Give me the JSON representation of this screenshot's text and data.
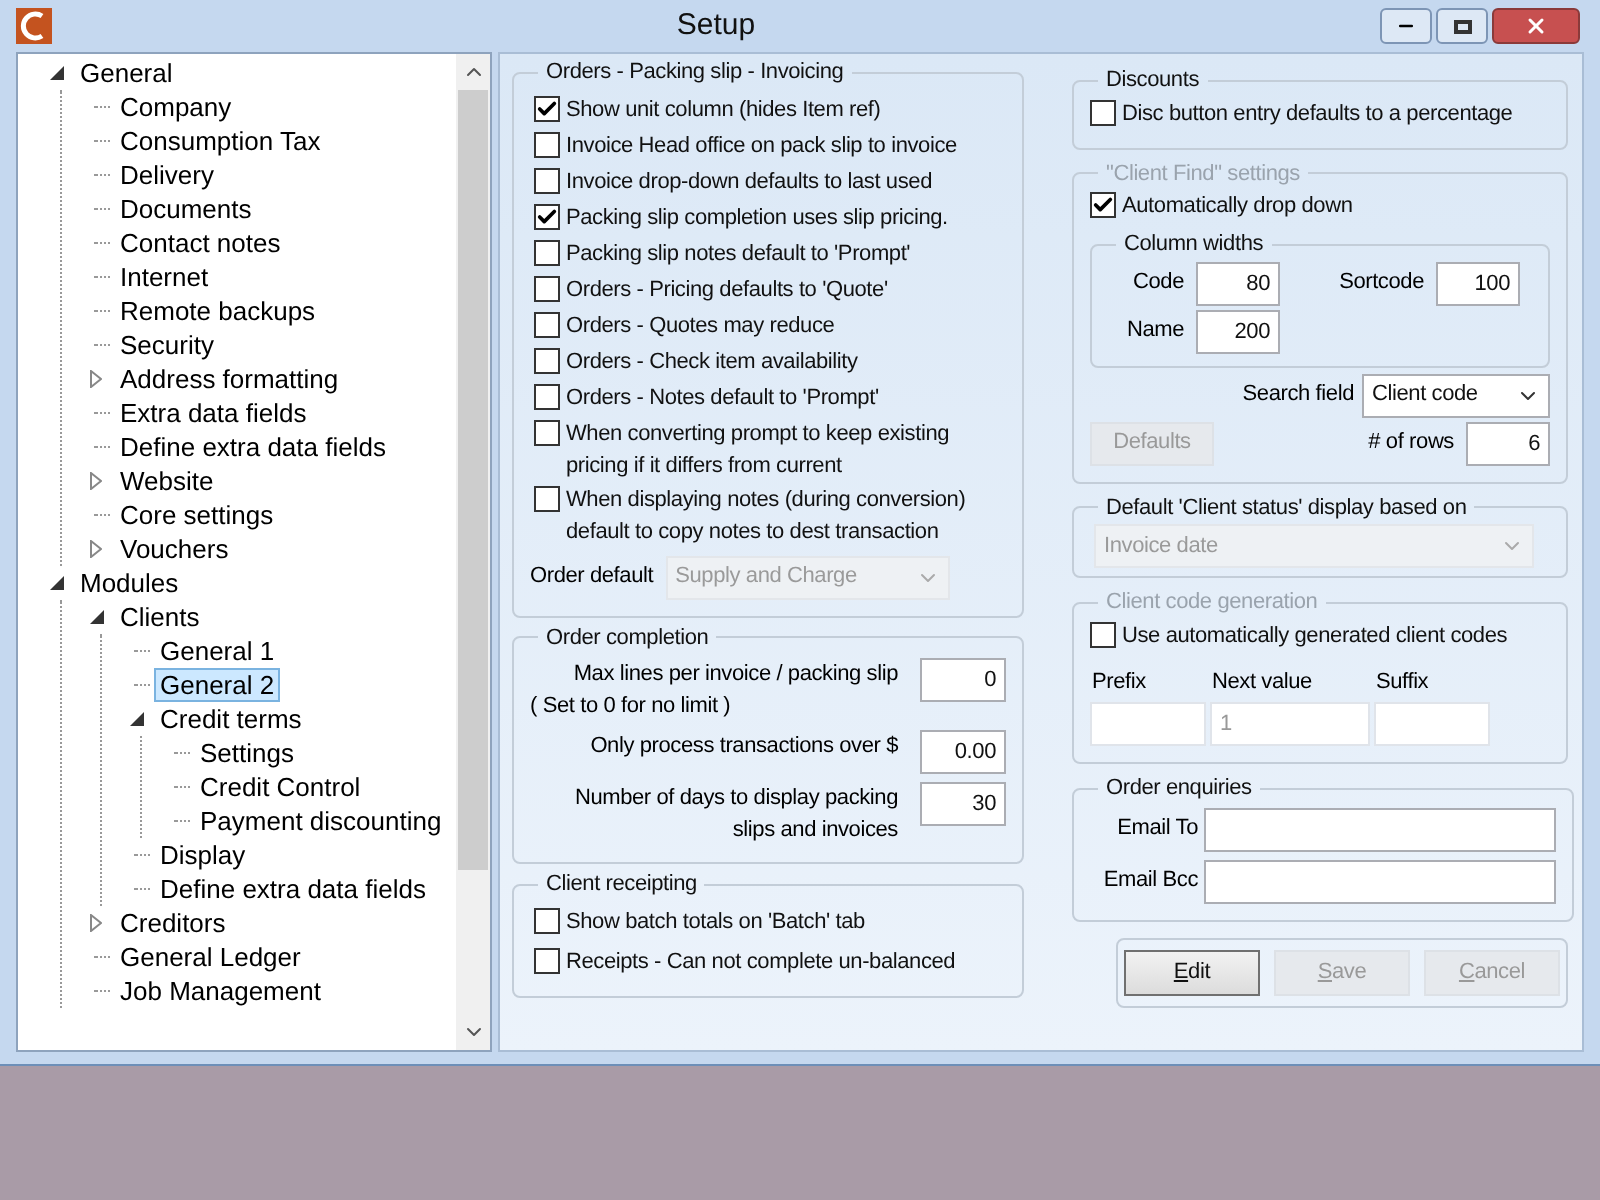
{
  "window": {
    "title": "Setup"
  },
  "tree": {
    "items": [
      {
        "label": "General",
        "expanded": true,
        "selected": false,
        "children": [
          {
            "label": "Company",
            "selected": false
          },
          {
            "label": "Consumption Tax",
            "selected": false
          },
          {
            "label": "Delivery",
            "selected": false
          },
          {
            "label": "Documents",
            "selected": false
          },
          {
            "label": "Contact notes",
            "selected": false
          },
          {
            "label": "Internet",
            "selected": false
          },
          {
            "label": "Remote backups",
            "selected": false
          },
          {
            "label": "Security",
            "selected": false
          },
          {
            "label": "Address formatting",
            "expanded": false,
            "selected": false
          },
          {
            "label": "Extra data fields",
            "selected": false
          },
          {
            "label": "Define extra data fields",
            "selected": false
          },
          {
            "label": "Website",
            "expanded": false,
            "selected": false
          },
          {
            "label": "Core settings",
            "selected": false
          },
          {
            "label": "Vouchers",
            "expanded": false,
            "selected": false
          }
        ]
      },
      {
        "label": "Modules",
        "expanded": true,
        "selected": false,
        "children": [
          {
            "label": "Clients",
            "expanded": true,
            "selected": false,
            "children": [
              {
                "label": "General 1",
                "selected": false
              },
              {
                "label": "General 2",
                "selected": true
              },
              {
                "label": "Credit terms",
                "expanded": true,
                "selected": false,
                "children": [
                  {
                    "label": "Settings",
                    "selected": false
                  },
                  {
                    "label": "Credit Control",
                    "selected": false
                  },
                  {
                    "label": "Payment discounting",
                    "selected": false
                  }
                ]
              },
              {
                "label": "Display",
                "selected": false
              },
              {
                "label": "Define extra data fields",
                "selected": false
              }
            ]
          },
          {
            "label": "Creditors",
            "expanded": false,
            "selected": false
          },
          {
            "label": "General Ledger",
            "selected": false
          },
          {
            "label": "Job Management",
            "selected": false
          }
        ]
      }
    ]
  },
  "orders": {
    "title": "Orders - Packing slip - Invoicing",
    "options": [
      {
        "label": "Show unit column (hides Item ref)",
        "checked": true
      },
      {
        "label": "Invoice Head office on pack slip to invoice",
        "checked": false
      },
      {
        "label": "Invoice drop-down defaults to last used",
        "checked": false
      },
      {
        "label": "Packing slip completion uses slip pricing.",
        "checked": true
      },
      {
        "label": "Packing slip notes default to 'Prompt'",
        "checked": false
      },
      {
        "label": "Orders - Pricing defaults to 'Quote'",
        "checked": false
      },
      {
        "label": "Orders - Quotes may reduce",
        "checked": false
      },
      {
        "label": "Orders - Check item availability",
        "checked": false
      },
      {
        "label": "Orders - Notes default to 'Prompt'",
        "checked": false
      },
      {
        "label": "When converting prompt to keep existing pricing if it differs from current",
        "checked": false
      },
      {
        "label": "When displaying notes (during conversion) default to copy notes to dest transaction",
        "checked": false
      }
    ],
    "order_default": {
      "label": "Order default",
      "value": "Supply and Charge",
      "disabled": true
    }
  },
  "order_completion": {
    "title": "Order completion",
    "fields": [
      {
        "label": "Max lines per invoice / packing slip",
        "note": "( Set to 0 for no limit )",
        "value": "0"
      },
      {
        "label": "Only process transactions over $",
        "value": "0.00"
      },
      {
        "label": "Number of days to display packing slips and invoices",
        "value": "30"
      }
    ]
  },
  "client_receipting": {
    "title": "Client receipting",
    "options": [
      {
        "label": "Show batch totals on 'Batch' tab",
        "checked": false
      },
      {
        "label": "Receipts - Can not complete un-balanced",
        "checked": false
      }
    ]
  },
  "discounts": {
    "title": "Discounts",
    "options": [
      {
        "label": "Disc button entry defaults to a percentage",
        "checked": false
      }
    ]
  },
  "client_find": {
    "title": "\"Client Find\" settings",
    "title_disabled": true,
    "auto_drop": {
      "label": "Automatically drop down",
      "checked": true
    },
    "column_widths": {
      "title": "Column widths",
      "fields": [
        {
          "label": "Code",
          "value": "80"
        },
        {
          "label": "Sortcode",
          "value": "100"
        },
        {
          "label": "Name",
          "value": "200"
        }
      ]
    },
    "search_field": {
      "label": "Search field",
      "value": "Client code"
    },
    "defaults_button": {
      "label": "Defaults",
      "disabled": true
    },
    "rows": {
      "label": "# of rows",
      "value": "6"
    }
  },
  "client_status": {
    "title": "Default 'Client status' display based on",
    "value": "Invoice date",
    "disabled": true
  },
  "client_code_generation": {
    "title": "Client code generation",
    "title_disabled": true,
    "option": {
      "label": "Use automatically generated client codes",
      "checked": false
    },
    "fields": [
      {
        "label": "Prefix",
        "disabled": true
      },
      {
        "label": "Next value",
        "value": "1",
        "disabled": true
      },
      {
        "label": "Suffix",
        "disabled": true
      }
    ]
  },
  "order_enquiries": {
    "title": "Order enquiries",
    "fields": [
      {
        "label": "Email To"
      },
      {
        "label": "Email Bcc"
      }
    ]
  },
  "buttons": [
    {
      "label": "Edit",
      "disabled": false
    },
    {
      "label": "Save",
      "disabled": true
    },
    {
      "label": "Cancel",
      "disabled": true
    }
  ]
}
